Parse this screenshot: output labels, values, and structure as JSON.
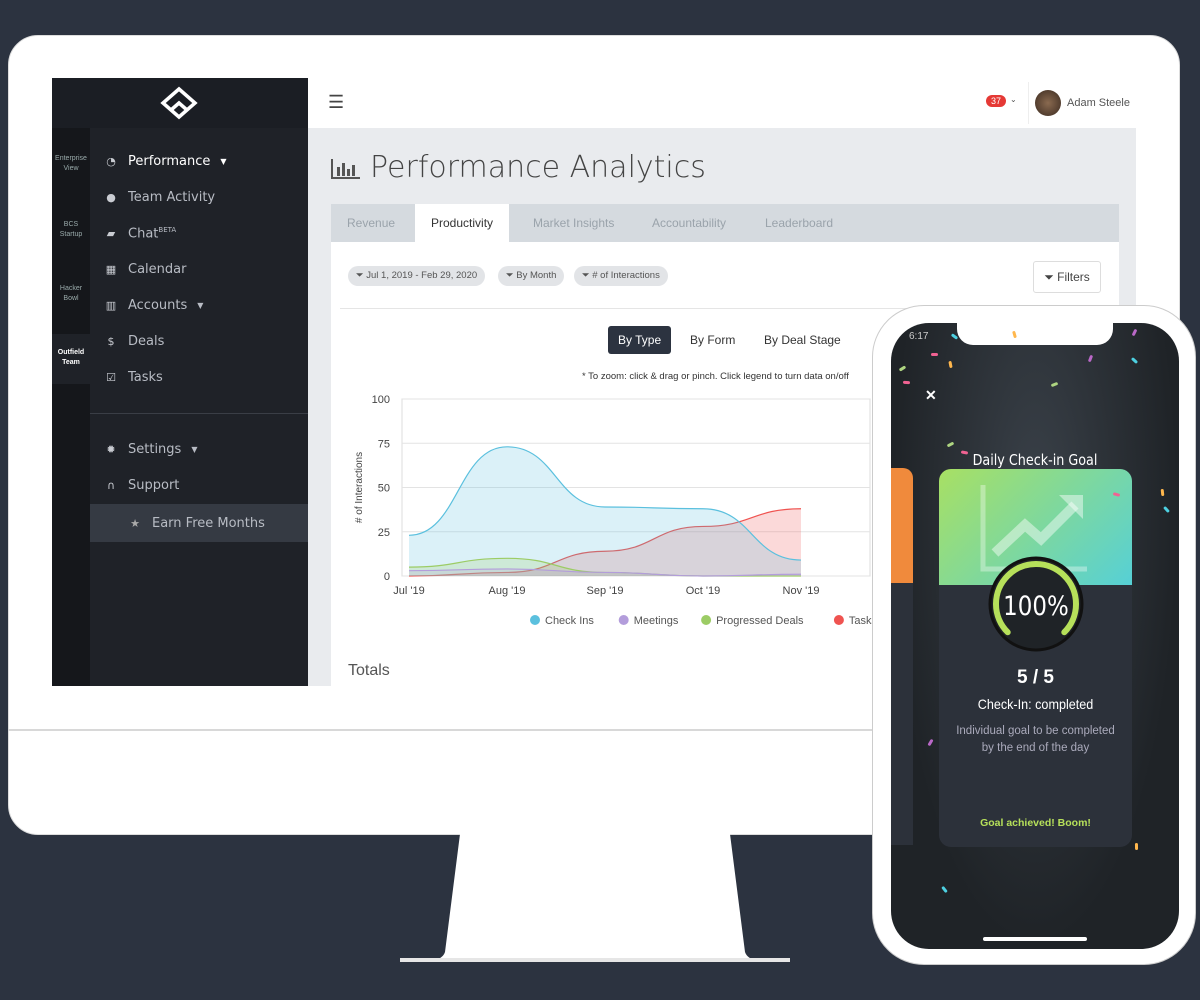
{
  "sidebar": {
    "teams": [
      "Enterprise View",
      "BCS Startup",
      "Hacker Bowl",
      "Outfield Team"
    ],
    "items": [
      {
        "label": "Performance",
        "icon": "dashboard-icon",
        "caret": true
      },
      {
        "label": "Team Activity",
        "icon": "map-pin-icon"
      },
      {
        "label": "Chat",
        "sup": "BETA",
        "icon": "chat-icon"
      },
      {
        "label": "Calendar",
        "icon": "calendar-icon"
      },
      {
        "label": "Accounts",
        "icon": "briefcase-icon",
        "caret": true
      },
      {
        "label": "Deals",
        "icon": "dollar-icon"
      },
      {
        "label": "Tasks",
        "icon": "checkbox-icon"
      }
    ],
    "settings": "Settings",
    "support": "Support",
    "earn": "Earn Free Months"
  },
  "header": {
    "notifications": "37",
    "user": "Adam Steele"
  },
  "page": {
    "title": "Performance Analytics",
    "tabs": [
      "Revenue",
      "Productivity",
      "Market Insights",
      "Accountability",
      "Leaderboard"
    ],
    "active_tab": "Productivity",
    "filters": [
      "Jul 1, 2019 - Feb 29, 2020",
      "By Month",
      "# of Interactions"
    ],
    "filters_button": "Filters",
    "segments": [
      "By Type",
      "By Form",
      "By Deal Stage"
    ],
    "active_segment": "By Type",
    "hint": "* To zoom: click & drag or pinch. Click legend to turn data on/off",
    "totals": "Totals"
  },
  "chart_data": {
    "type": "area",
    "ylabel": "# of Interactions",
    "ylim": [
      0,
      100
    ],
    "yticks": [
      "0",
      "25",
      "50",
      "75",
      "100"
    ],
    "categories": [
      "Jul '19",
      "Aug '19",
      "Sep '19",
      "Oct '19",
      "Nov '19"
    ],
    "series": [
      {
        "name": "Check Ins",
        "color": "#5bc0de",
        "values": [
          23,
          73,
          39,
          38,
          9
        ]
      },
      {
        "name": "Meetings",
        "color": "#b39ddb",
        "values": [
          3,
          4,
          2,
          0,
          1
        ]
      },
      {
        "name": "Progressed Deals",
        "color": "#9ccc65",
        "values": [
          5,
          10,
          2,
          0,
          0
        ]
      },
      {
        "name": "Tasks",
        "color": "#ef5350",
        "values": [
          0,
          2,
          14,
          28,
          38
        ]
      }
    ]
  },
  "phone": {
    "time": "6:17",
    "title": "Daily Check-in Goal",
    "percent": "100%",
    "progress": 1.0,
    "count": "5 / 5",
    "status": "Check-In: completed",
    "desc": "Individual goal to be completed by the end of the day",
    "footer": "Goal achieved! Boom!"
  }
}
